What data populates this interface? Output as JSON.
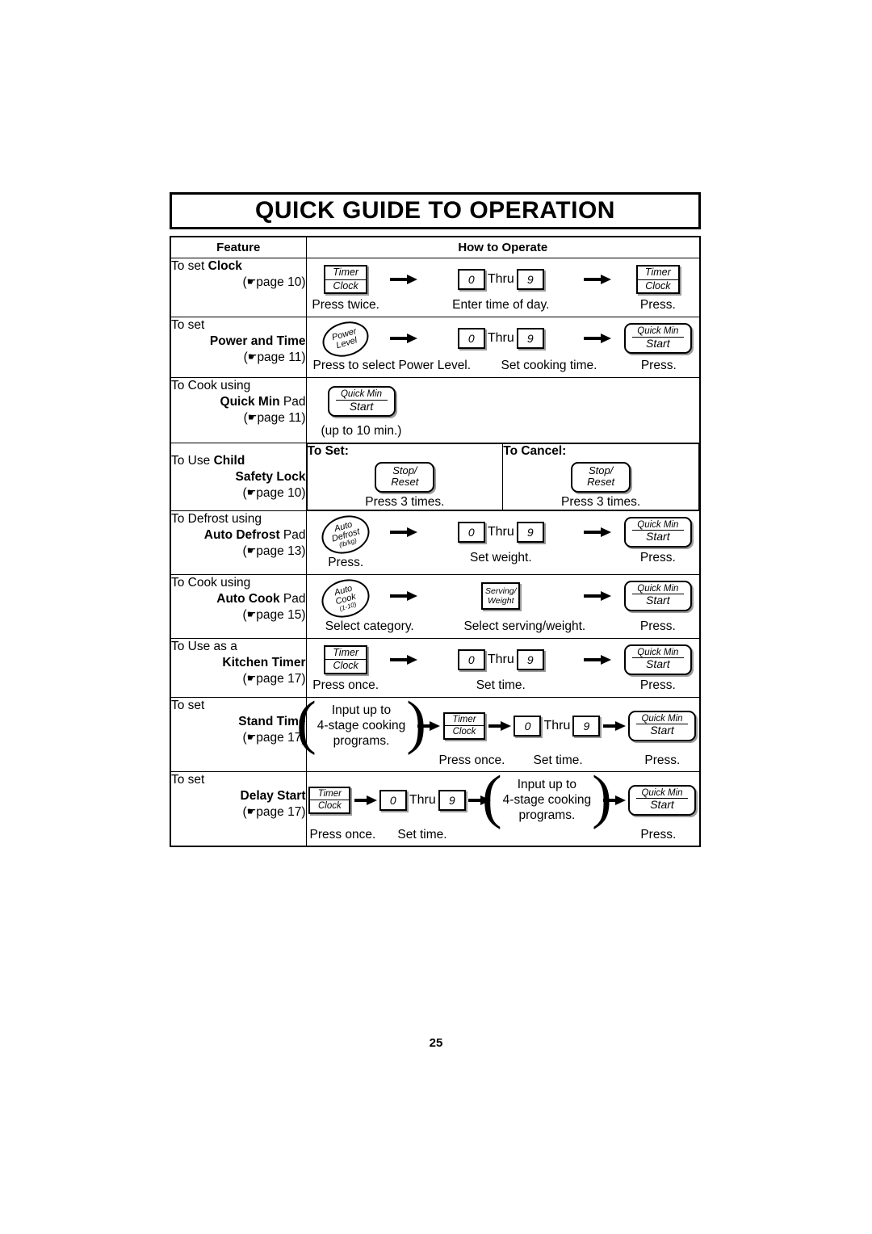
{
  "document": {
    "title": "QUICK GUIDE TO OPERATION",
    "page_number": "25",
    "hand_glyph": "☛"
  },
  "table": {
    "headers": {
      "feature": "Feature",
      "how_to_operate": "How to Operate"
    },
    "rows": [
      {
        "id": "clock",
        "feature": {
          "line1_prefix": "To set ",
          "line1_bold": "Clock",
          "line2_bold": "",
          "line2_suffix": "",
          "page_ref_open": "(",
          "page_ref_text": "page 10",
          "page_ref_close": ")"
        },
        "steps": [
          {
            "icon": "timer-clock-pad",
            "icon_top": "Timer",
            "icon_bottom": "Clock",
            "caption": "Press twice."
          },
          {
            "icon": "arrow-right",
            "caption": ""
          },
          {
            "icon": "number-range",
            "from": "0",
            "thru": "Thru",
            "to": "9",
            "caption": "Enter time of day."
          },
          {
            "icon": "arrow-right",
            "caption": ""
          },
          {
            "icon": "timer-clock-pad",
            "icon_top": "Timer",
            "icon_bottom": "Clock",
            "caption": "Press."
          }
        ]
      },
      {
        "id": "power-and-time",
        "feature": {
          "line1_prefix": "To set",
          "line1_bold": "",
          "line2_bold": "Power and Time",
          "line2_suffix": "",
          "page_ref_open": "(",
          "page_ref_text": "page 11",
          "page_ref_close": ")"
        },
        "steps": [
          {
            "icon": "power-level-dial",
            "icon_l1": "Power",
            "icon_l2": "Level",
            "icon_l3": "",
            "caption": "Press to select Power Level."
          },
          {
            "icon": "arrow-right",
            "caption": ""
          },
          {
            "icon": "number-range",
            "from": "0",
            "thru": "Thru",
            "to": "9",
            "caption": "Set cooking time."
          },
          {
            "icon": "arrow-right",
            "caption": ""
          },
          {
            "icon": "quick-min-start-pad",
            "icon_top": "Quick Min",
            "icon_bottom": "Start",
            "caption": "Press."
          }
        ]
      },
      {
        "id": "quick-min",
        "feature": {
          "line1_prefix": "To Cook using",
          "line1_bold": "",
          "line2_bold": "Quick Min",
          "line2_suffix": " Pad",
          "page_ref_open": "(",
          "page_ref_text": "page 11",
          "page_ref_close": ")"
        },
        "steps": [
          {
            "icon": "quick-min-start-pad",
            "icon_top": "Quick Min",
            "icon_bottom": "Start",
            "caption": "(up to 10 min.)"
          }
        ]
      },
      {
        "id": "child-safety-lock",
        "feature": {
          "line1_prefix": "To Use ",
          "line1_bold": "Child",
          "line2_bold": "Safety Lock",
          "line2_suffix": "",
          "page_ref_open": "(",
          "page_ref_text": "page 10",
          "page_ref_close": ")"
        },
        "split": {
          "set": {
            "title": "To Set:",
            "icon_top": "Stop/",
            "icon_bottom": "Reset",
            "caption": "Press 3 times."
          },
          "cancel": {
            "title": "To Cancel:",
            "icon_top": "Stop/",
            "icon_bottom": "Reset",
            "caption": "Press 3 times."
          }
        }
      },
      {
        "id": "auto-defrost",
        "feature": {
          "line1_prefix": "To Defrost using",
          "line1_bold": "",
          "line2_bold": "Auto Defrost",
          "line2_suffix": " Pad",
          "page_ref_open": "(",
          "page_ref_text": "page 13",
          "page_ref_close": ")"
        },
        "steps": [
          {
            "icon": "auto-defrost-dial",
            "icon_l1": "Auto",
            "icon_l2": "Defrost",
            "icon_l3": "(lb/kg)",
            "caption": "Press."
          },
          {
            "icon": "arrow-right",
            "caption": ""
          },
          {
            "icon": "number-range",
            "from": "0",
            "thru": "Thru",
            "to": "9",
            "caption": "Set weight."
          },
          {
            "icon": "arrow-right",
            "caption": ""
          },
          {
            "icon": "quick-min-start-pad",
            "icon_top": "Quick Min",
            "icon_bottom": "Start",
            "caption": "Press."
          }
        ]
      },
      {
        "id": "auto-cook",
        "feature": {
          "line1_prefix": "To Cook using",
          "line1_bold": "",
          "line2_bold": "Auto Cook",
          "line2_suffix": " Pad",
          "page_ref_open": "(",
          "page_ref_text": "page 15",
          "page_ref_close": ")"
        },
        "steps": [
          {
            "icon": "auto-cook-dial",
            "icon_l1": "Auto",
            "icon_l2": "Cook",
            "icon_l3": "(1-10)",
            "caption": "Select category."
          },
          {
            "icon": "arrow-right",
            "caption": ""
          },
          {
            "icon": "serving-weight-pad",
            "icon_top": "Serving/",
            "icon_bottom": "Weight",
            "caption": "Select serving/weight."
          },
          {
            "icon": "arrow-right",
            "caption": ""
          },
          {
            "icon": "quick-min-start-pad",
            "icon_top": "Quick Min",
            "icon_bottom": "Start",
            "caption": "Press."
          }
        ]
      },
      {
        "id": "kitchen-timer",
        "feature": {
          "line1_prefix": "To Use as a",
          "line1_bold": "",
          "line2_bold": "Kitchen Timer",
          "line2_suffix": "",
          "page_ref_open": "(",
          "page_ref_text": "page 17",
          "page_ref_close": ")"
        },
        "steps": [
          {
            "icon": "timer-clock-pad",
            "icon_top": "Timer",
            "icon_bottom": "Clock",
            "caption": "Press once."
          },
          {
            "icon": "arrow-right",
            "caption": ""
          },
          {
            "icon": "number-range",
            "from": "0",
            "thru": "Thru",
            "to": "9",
            "caption": "Set time."
          },
          {
            "icon": "arrow-right",
            "caption": ""
          },
          {
            "icon": "quick-min-start-pad",
            "icon_top": "Quick Min",
            "icon_bottom": "Start",
            "caption": "Press."
          }
        ]
      },
      {
        "id": "stand-time",
        "feature": {
          "line1_prefix": "To set",
          "line1_bold": "",
          "line2_bold": "Stand Time",
          "line2_suffix": "",
          "page_ref_open": "(",
          "page_ref_text": "page 17",
          "page_ref_close": ")"
        },
        "steps": [
          {
            "icon": "paren-note",
            "note_l1": "Input up to",
            "note_l2": "4-stage cooking",
            "note_l3": "programs.",
            "caption": ""
          },
          {
            "icon": "arrow-right",
            "caption": ""
          },
          {
            "icon": "timer-clock-pad",
            "icon_top": "Timer",
            "icon_bottom": "Clock",
            "caption": "Press once."
          },
          {
            "icon": "arrow-right",
            "caption": ""
          },
          {
            "icon": "number-range",
            "from": "0",
            "thru": "Thru",
            "to": "9",
            "caption": "Set time."
          },
          {
            "icon": "arrow-right",
            "caption": ""
          },
          {
            "icon": "quick-min-start-pad",
            "icon_top": "Quick Min",
            "icon_bottom": "Start",
            "caption": "Press."
          }
        ]
      },
      {
        "id": "delay-start",
        "feature": {
          "line1_prefix": "To set",
          "line1_bold": "",
          "line2_bold": "Delay Start",
          "line2_suffix": "",
          "page_ref_open": "(",
          "page_ref_text": "page 17",
          "page_ref_close": ")"
        },
        "steps": [
          {
            "icon": "timer-clock-pad",
            "icon_top": "Timer",
            "icon_bottom": "Clock",
            "caption": "Press once."
          },
          {
            "icon": "arrow-right",
            "caption": ""
          },
          {
            "icon": "number-range",
            "from": "0",
            "thru": "Thru",
            "to": "9",
            "caption": "Set time."
          },
          {
            "icon": "arrow-right",
            "caption": ""
          },
          {
            "icon": "paren-note",
            "note_l1": "Input up to",
            "note_l2": "4-stage cooking",
            "note_l3": "programs.",
            "caption": ""
          },
          {
            "icon": "arrow-right",
            "caption": ""
          },
          {
            "icon": "quick-min-start-pad",
            "icon_top": "Quick Min",
            "icon_bottom": "Start",
            "caption": "Press."
          }
        ]
      }
    ]
  }
}
